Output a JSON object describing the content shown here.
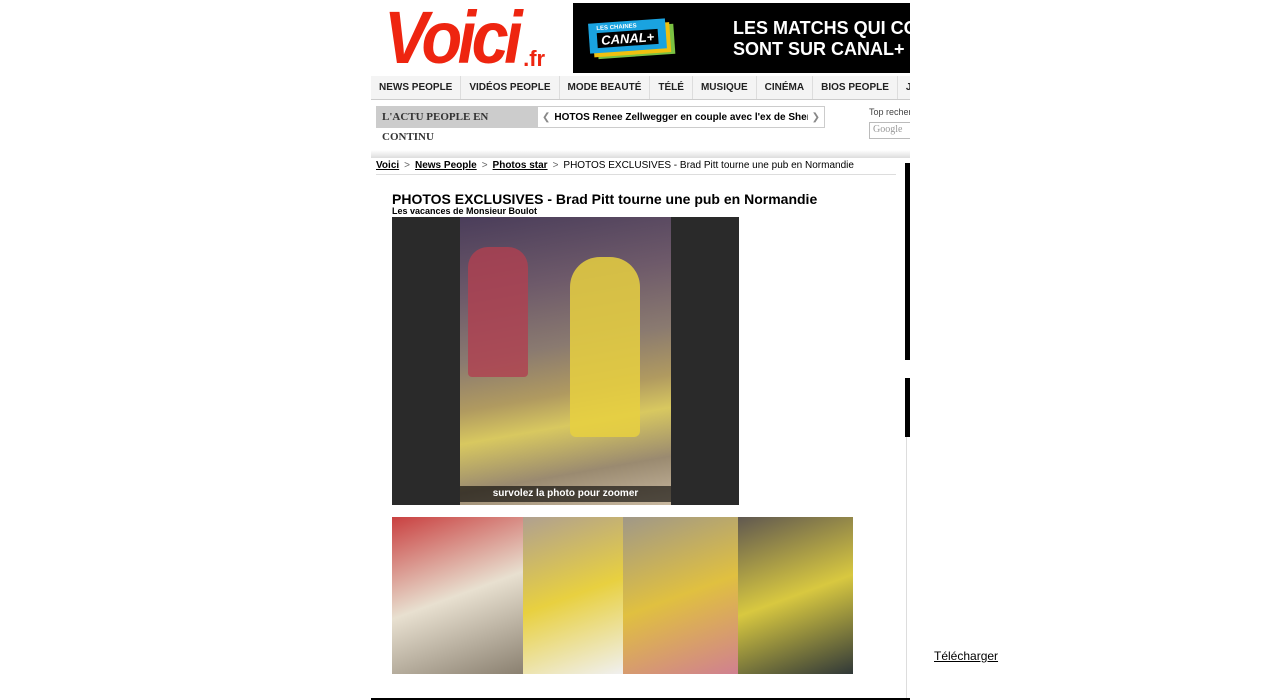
{
  "logo": {
    "main": "Voici",
    "suffix": ".fr"
  },
  "ad": {
    "brand_small": "LES CHAINES",
    "brand": "CANAL+",
    "line1": "LES MATCHS QUI CO",
    "line2": "SONT SUR CANAL+"
  },
  "nav": {
    "items": [
      "NEWS PEOPLE",
      "VIDÉOS PEOPLE",
      "MODE BEAUTÉ",
      "TÉLÉ",
      "MUSIQUE",
      "CINÉMA",
      "BIOS PEOPLE",
      "JEUX"
    ]
  },
  "ticker": {
    "label": "L'ACTU PEOPLE EN CONTINU",
    "text": "HOTOS Renee Zellwegger en couple avec l'ex de Sheryl Crow",
    "prev_icon": "chevron-left-icon",
    "next_icon": "chevron-right-icon"
  },
  "search": {
    "top_label": "Top recherches",
    "placeholder": "Google"
  },
  "breadcrumb": {
    "items": [
      "Voici",
      "News People",
      "Photos star"
    ],
    "current": "PHOTOS EXCLUSIVES - Brad Pitt tourne une pub en Normandie"
  },
  "article": {
    "title": "PHOTOS EXCLUSIVES - Brad Pitt tourne une pub en Normandie",
    "subtitle": "Les vacances de Monsieur Boulot",
    "photo_caption": "survolez la photo pour zoomer"
  },
  "thumbnails": [
    {
      "colors": [
        "#c94040",
        "#e8e0d0",
        "#8a8070"
      ]
    },
    {
      "colors": [
        "#b0a090",
        "#e8d040",
        "#f0f0f0"
      ]
    },
    {
      "colors": [
        "#a09888",
        "#e0c040",
        "#d08090"
      ]
    },
    {
      "colors": [
        "#605850",
        "#d8c840",
        "#303838"
      ]
    }
  ],
  "side": {
    "download": "Télécharger"
  }
}
